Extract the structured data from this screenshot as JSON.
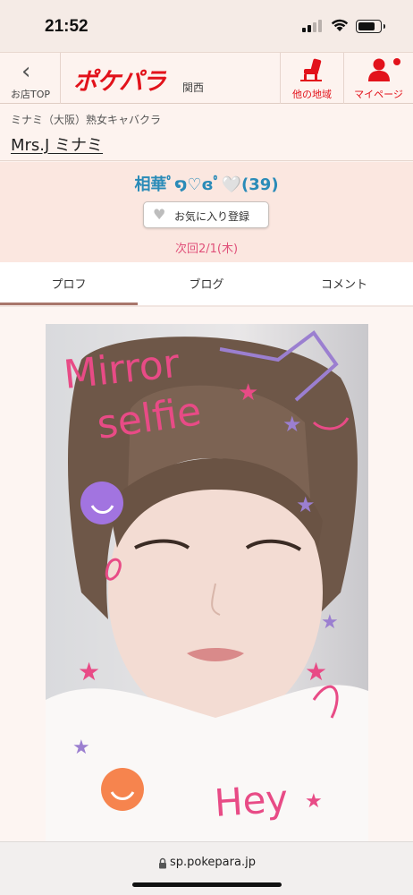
{
  "status_bar": {
    "time": "21:52",
    "battery_level": 0.8
  },
  "header": {
    "back_label": "お店TOP",
    "logo_text": "ポケパラ",
    "region": "関西",
    "nav_area_label": "他の地域",
    "nav_mypage_label": "マイページ",
    "brand_color": "#e2121b"
  },
  "shop": {
    "category": "ミナミ（大阪）熟女キャバクラ",
    "name": "Mrs.J ミナミ"
  },
  "profile": {
    "name": "相華ﾟ໑♡ɞﾟ🤍(39)",
    "favorite_button": "お気に入り登録",
    "next_date": "次回2/1(木)",
    "name_color": "#2a8bb8"
  },
  "tabs": [
    {
      "label": "プロフ",
      "active": true
    },
    {
      "label": "ブログ",
      "active": false
    },
    {
      "label": "コメント",
      "active": false
    }
  ],
  "photo": {
    "doodle_text_1": "Mirror",
    "doodle_text_2": "selfie",
    "doodle_text_3": "Hey"
  },
  "url_bar": {
    "url": "sp.pokepara.jp"
  }
}
